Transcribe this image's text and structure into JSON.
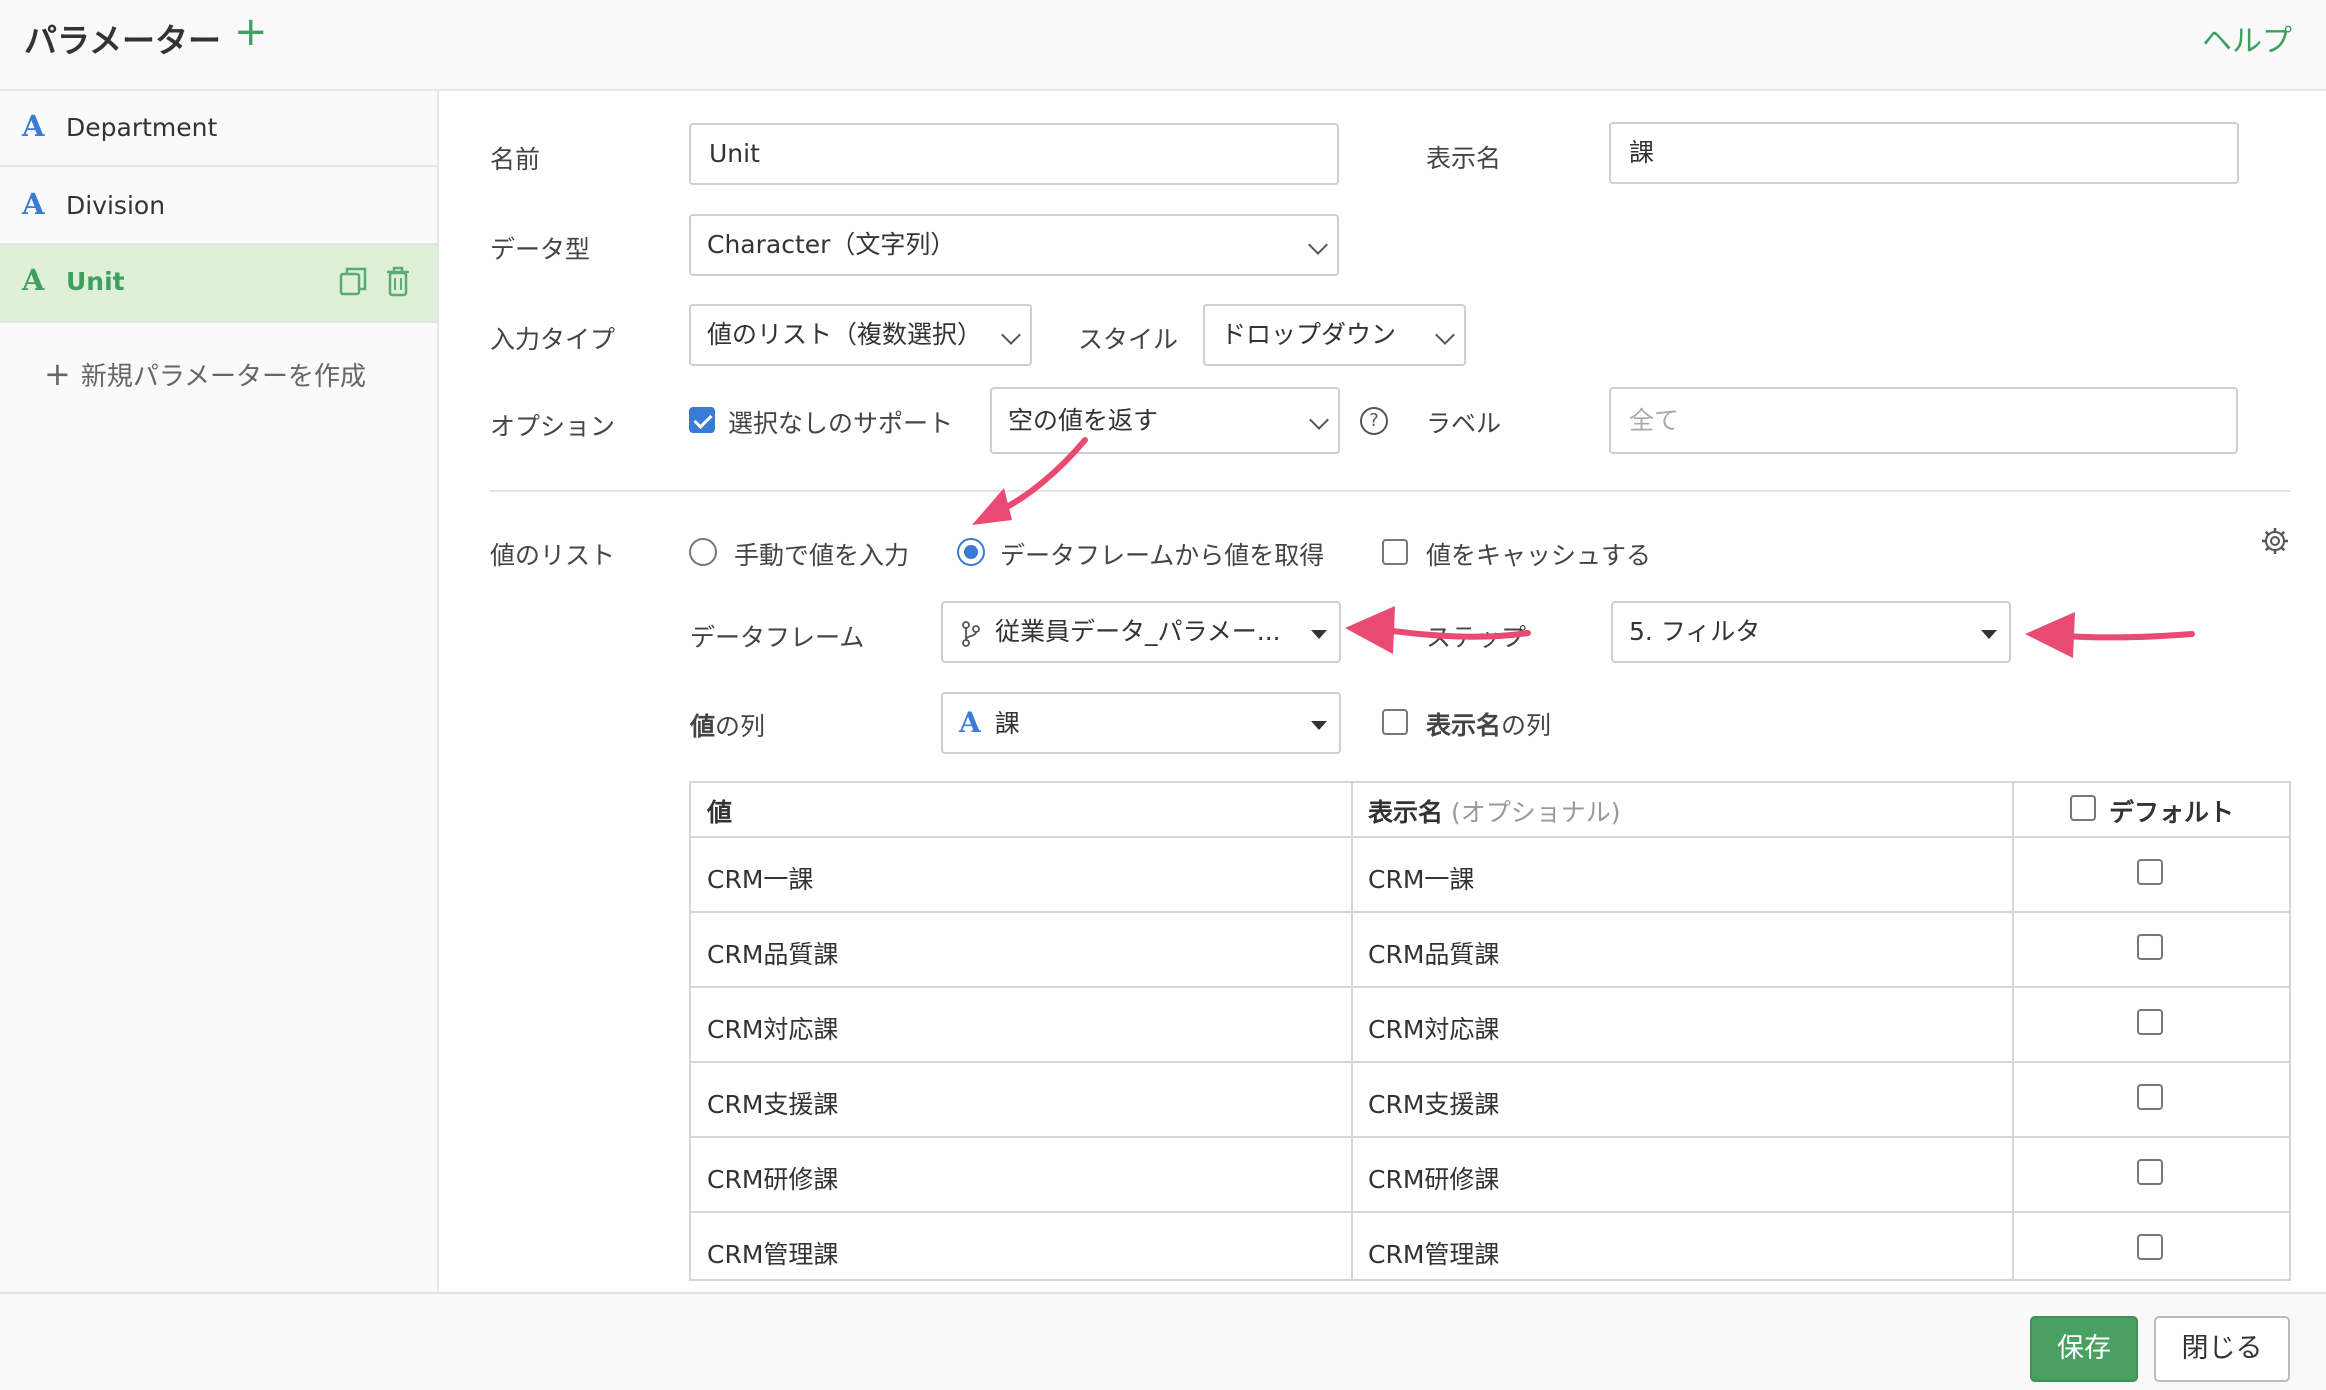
{
  "header": {
    "title": "パラメーター",
    "add_label": "+",
    "help": "ヘルプ"
  },
  "sidebar": {
    "items": [
      {
        "icon": "A",
        "label": "Department"
      },
      {
        "icon": "A",
        "label": "Division"
      },
      {
        "icon": "A",
        "label": "Unit"
      }
    ],
    "create_label": "新規パラメーターを作成"
  },
  "form": {
    "name_label": "名前",
    "name_value": "Unit",
    "display_name_label": "表示名",
    "display_name_value": "課",
    "data_type_label": "データ型",
    "data_type_value": "Character（文字列）",
    "input_type_label": "入力タイプ",
    "input_type_value": "値のリスト（複数選択）",
    "style_label": "スタイル",
    "style_value": "ドロップダウン",
    "option_label": "オプション",
    "no_selection_label": "選択なしのサポート",
    "empty_value_option": "空の値を返す",
    "help_icon_glyph": "?",
    "label_label": "ラベル",
    "label_placeholder": "全て"
  },
  "values_list": {
    "label": "値のリスト",
    "radio_manual": "手動で値を入力",
    "radio_dataframe": "データフレームから値を取得",
    "cache_label": "値をキャッシュする",
    "dataframe_label": "データフレーム",
    "dataframe_value": "従業員データ_パラメー...",
    "step_label": "ステップ",
    "step_value": "5. フィルタ",
    "value_column_label_bold": "値",
    "value_column_label_rest": "の列",
    "value_column_value": "課",
    "value_column_icon": "A",
    "display_column_label_bold": "表示名",
    "display_column_label_rest": "の列"
  },
  "table": {
    "headers": {
      "value": "値",
      "display_bold": "表示名",
      "display_optional": "(オプショナル)",
      "default": "デフォルト"
    },
    "rows": [
      {
        "value": "CRM一課",
        "display": "CRM一課"
      },
      {
        "value": "CRM品質課",
        "display": "CRM品質課"
      },
      {
        "value": "CRM対応課",
        "display": "CRM対応課"
      },
      {
        "value": "CRM支援課",
        "display": "CRM支援課"
      },
      {
        "value": "CRM研修課",
        "display": "CRM研修課"
      },
      {
        "value": "CRM管理課",
        "display": "CRM管理課"
      }
    ]
  },
  "footer": {
    "save": "保存",
    "close": "閉じる"
  },
  "colors": {
    "accent_green": "#3f9f5f",
    "save_button": "#4a9f63",
    "active_item_bg": "#dff0d8",
    "blue": "#3a7bd5",
    "annotation_arrow": "#e84a72"
  }
}
